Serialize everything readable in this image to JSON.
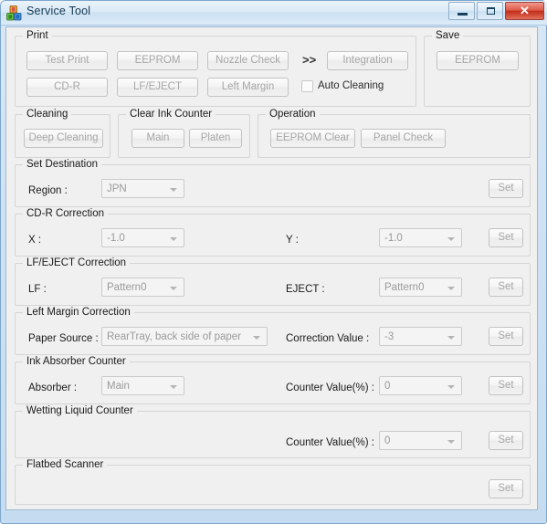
{
  "window": {
    "title": "Service Tool",
    "icon": "service-tool-icon",
    "controls": {
      "minimize": "minimize-icon",
      "maximize": "maximize-icon",
      "close": "✕"
    }
  },
  "print": {
    "legend": "Print",
    "buttons": {
      "test_print": "Test Print",
      "eeprom": "EEPROM",
      "nozzle_check": "Nozzle Check",
      "integration": "Integration",
      "cdr": "CD-R",
      "lf_eject": "LF/EJECT",
      "left_margin": "Left Margin"
    },
    "arrow": ">>",
    "auto_cleaning": {
      "label": "Auto Cleaning",
      "checked": false
    }
  },
  "save": {
    "legend": "Save",
    "eeprom_label": "EEPROM"
  },
  "cleaning": {
    "legend": "Cleaning",
    "deep_cleaning": "Deep Cleaning"
  },
  "clear_ink_counter": {
    "legend": "Clear Ink Counter",
    "main": "Main",
    "platen": "Platen"
  },
  "operation": {
    "legend": "Operation",
    "eeprom_clear": "EEPROM Clear",
    "panel_check": "Panel Check"
  },
  "set_destination": {
    "legend": "Set Destination",
    "region_label": "Region :",
    "region_value": "JPN",
    "set_label": "Set"
  },
  "cdr_correction": {
    "legend": "CD-R Correction",
    "x_label": "X :",
    "x_value": "-1.0",
    "y_label": "Y :",
    "y_value": "-1.0",
    "set_label": "Set"
  },
  "lf_eject_correction": {
    "legend": "LF/EJECT Correction",
    "lf_label": "LF :",
    "lf_value": "Pattern0",
    "eject_label": "EJECT :",
    "eject_value": "Pattern0",
    "set_label": "Set"
  },
  "left_margin_correction": {
    "legend": "Left Margin Correction",
    "paper_source_label": "Paper Source :",
    "paper_source_value": "RearTray, back side of paper",
    "correction_label": "Correction Value :",
    "correction_value": "-3",
    "set_label": "Set"
  },
  "ink_absorber_counter": {
    "legend": "Ink Absorber Counter",
    "absorber_label": "Absorber :",
    "absorber_value": "Main",
    "counter_label": "Counter Value(%) :",
    "counter_value": "0",
    "set_label": "Set"
  },
  "wetting_liquid_counter": {
    "legend": "Wetting Liquid Counter",
    "counter_label": "Counter Value(%) :",
    "counter_value": "0",
    "set_label": "Set"
  },
  "flatbed_scanner": {
    "legend": "Flatbed Scanner",
    "set_label": "Set"
  },
  "colors": {
    "title_text": "#11384f",
    "close_button": "#c22e1b",
    "client_bg": "#f0f0f0",
    "disabled_text": "#a6a6a6",
    "label_text": "#1a1a1a"
  }
}
